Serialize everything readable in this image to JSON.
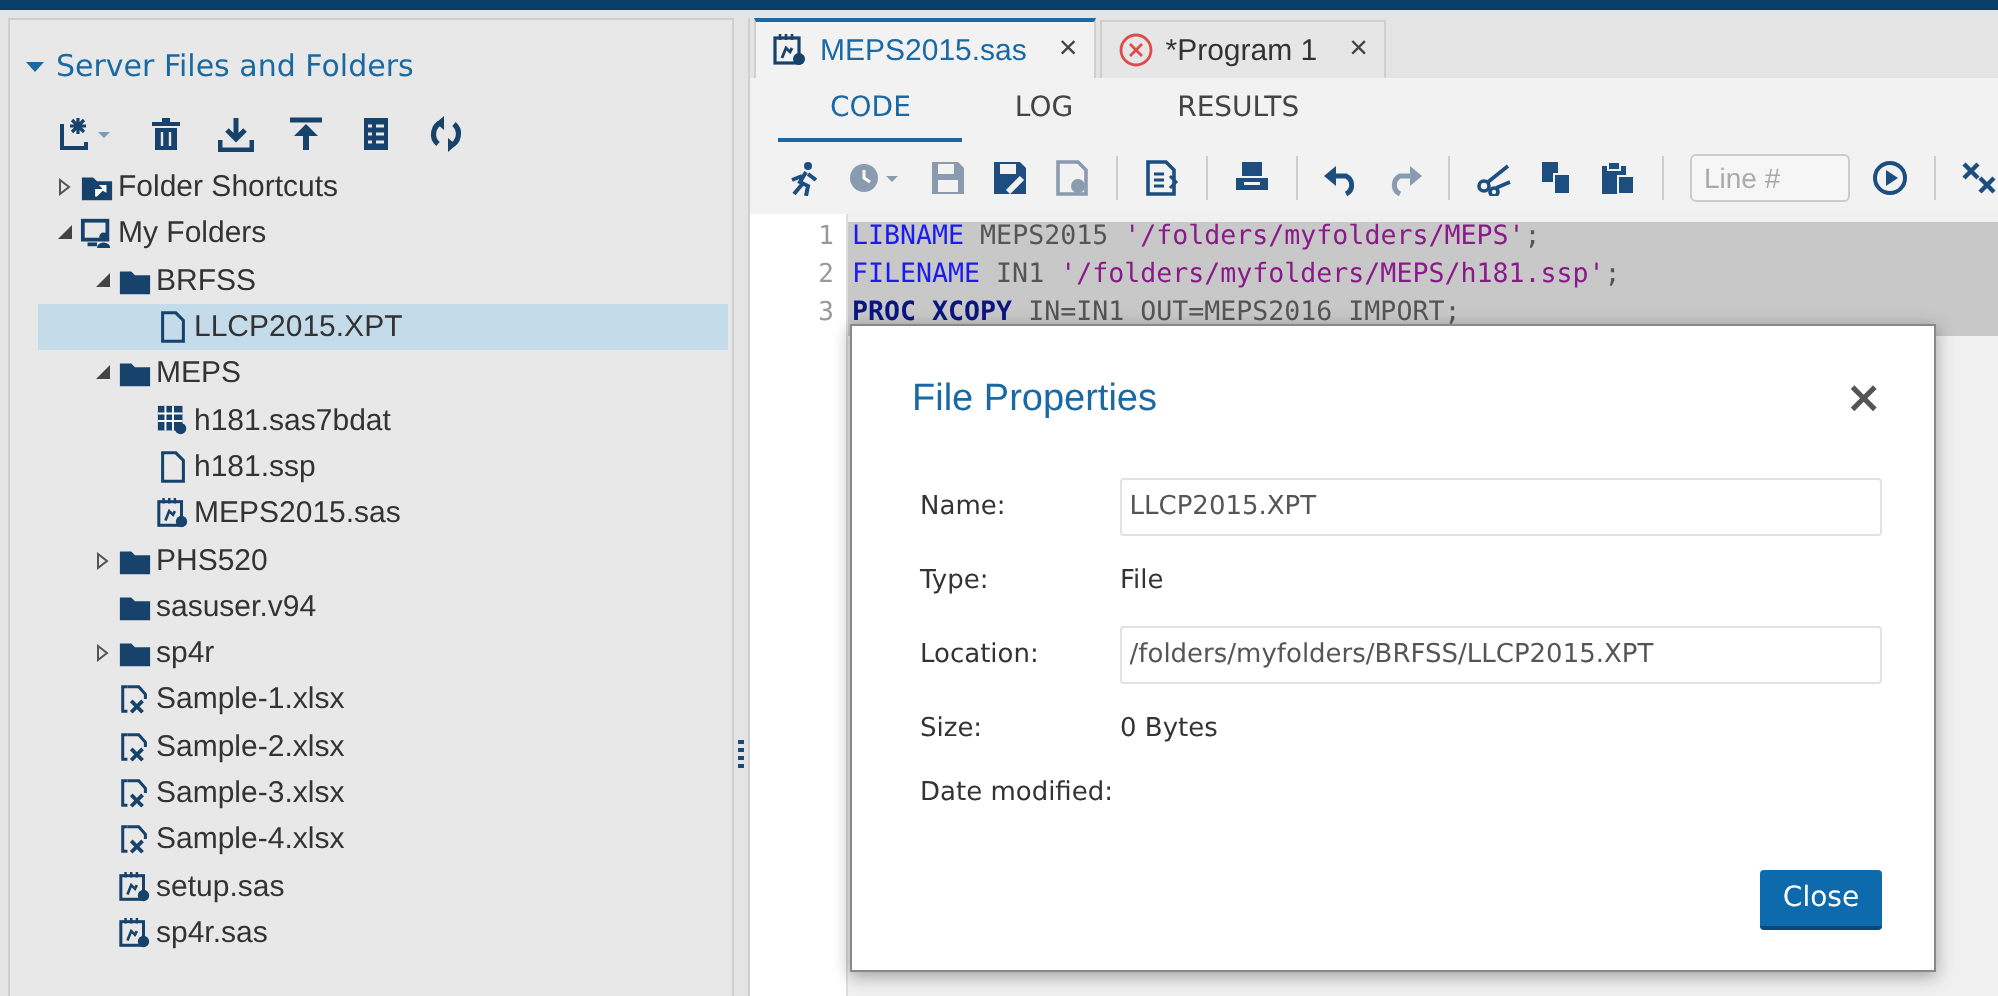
{
  "explorer": {
    "title": "Server Files and Folders",
    "expanded": true,
    "toolbar": [
      {
        "kind": "new"
      },
      {
        "kind": "delete"
      },
      {
        "kind": "download"
      },
      {
        "kind": "upload"
      },
      {
        "kind": "properties"
      },
      {
        "kind": "refresh"
      }
    ],
    "tree": [
      {
        "label": "Folder Shortcuts",
        "kind": "shortcut",
        "expanded": false,
        "selected": false
      },
      {
        "label": "My Folders",
        "kind": "computer",
        "expanded": true,
        "selected": false,
        "children": [
          {
            "label": "BRFSS",
            "kind": "folder",
            "expanded": true,
            "selected": false,
            "children": [
              {
                "label": "LLCP2015.XPT",
                "kind": "document",
                "selected": true
              }
            ]
          },
          {
            "label": "MEPS",
            "kind": "folder",
            "expanded": true,
            "selected": false,
            "children": [
              {
                "label": "h181.sas7bdat",
                "kind": "dataset",
                "selected": false
              },
              {
                "label": "h181.ssp",
                "kind": "document",
                "selected": false
              },
              {
                "label": "MEPS2015.sas",
                "kind": "program",
                "selected": false
              }
            ]
          },
          {
            "label": "PHS520",
            "kind": "folder",
            "expanded": false,
            "selected": false
          },
          {
            "label": "sasuser.v94",
            "kind": "folder",
            "selected": false
          },
          {
            "label": "sp4r",
            "kind": "folder",
            "expanded": false,
            "selected": false
          },
          {
            "label": "Sample-1.xlsx",
            "kind": "excel",
            "selected": false
          },
          {
            "label": "Sample-2.xlsx",
            "kind": "excel",
            "selected": false
          },
          {
            "label": "Sample-3.xlsx",
            "kind": "excel",
            "selected": false
          },
          {
            "label": "Sample-4.xlsx",
            "kind": "excel",
            "selected": false
          },
          {
            "label": "setup.sas",
            "kind": "program",
            "selected": false
          },
          {
            "label": "sp4r.sas",
            "kind": "program",
            "selected": false
          }
        ]
      }
    ]
  },
  "editor": {
    "tabs": [
      {
        "label": "MEPS2015.sas",
        "kind": "program",
        "selected": true,
        "close": "×"
      },
      {
        "label": "*Program 1",
        "kind": "error",
        "selected": false,
        "close": "×"
      }
    ],
    "subtabs": [
      {
        "label": "CODE",
        "selected": true
      },
      {
        "label": "LOG",
        "selected": false
      },
      {
        "label": "RESULTS",
        "selected": false
      }
    ],
    "toolbar": [
      {
        "kind": "run",
        "disabled": false
      },
      {
        "kind": "history",
        "disabled": true
      },
      {
        "kind": "save",
        "disabled": true
      },
      {
        "kind": "save-as",
        "disabled": false
      },
      {
        "kind": "save-other",
        "disabled": true
      },
      {
        "kind": "separator"
      },
      {
        "kind": "format",
        "disabled": false
      },
      {
        "kind": "separator"
      },
      {
        "kind": "print",
        "disabled": false
      },
      {
        "kind": "separator"
      },
      {
        "kind": "undo",
        "disabled": false
      },
      {
        "kind": "redo",
        "disabled": true
      },
      {
        "kind": "separator"
      },
      {
        "kind": "cut",
        "disabled": false
      },
      {
        "kind": "copy",
        "disabled": false
      },
      {
        "kind": "paste",
        "disabled": false
      },
      {
        "kind": "separator"
      },
      {
        "kind": "line-field",
        "placeholder": "Line #"
      },
      {
        "kind": "go",
        "disabled": false
      },
      {
        "kind": "separator"
      },
      {
        "kind": "clear",
        "disabled": false
      }
    ],
    "lines": [
      {
        "number": "1",
        "selected": true,
        "tokens": [
          {
            "kind": "keyword",
            "text": "LIBNAME"
          },
          {
            "kind": "plain",
            "text": " MEPS2015 "
          },
          {
            "kind": "string",
            "text": "'/folders/myfolders/MEPS'"
          },
          {
            "kind": "plain",
            "text": ";"
          }
        ]
      },
      {
        "number": "2",
        "selected": true,
        "tokens": [
          {
            "kind": "keyword",
            "text": "FILENAME"
          },
          {
            "kind": "plain",
            "text": " IN1 "
          },
          {
            "kind": "string",
            "text": "'/folders/myfolders/MEPS/h181.ssp'"
          },
          {
            "kind": "plain",
            "text": ";"
          }
        ]
      },
      {
        "number": "3",
        "selected": true,
        "tokens": [
          {
            "kind": "proc",
            "text": "PROC XCOPY"
          },
          {
            "kind": "plain",
            "text": " IN=IN1 OUT=MEPS2016 IMPORT;"
          }
        ]
      }
    ]
  },
  "dialog": {
    "title": "File Properties",
    "close": "×",
    "rows": [
      {
        "label": "Name:",
        "value": "LLCP2015.XPT",
        "kind": "field"
      },
      {
        "label": "Type:",
        "value": "File",
        "kind": "text"
      },
      {
        "label": "Location:",
        "value": "/folders/myfolders/BRFSS/LLCP2015.XPT",
        "kind": "field"
      },
      {
        "label": "Size:",
        "value": "0 Bytes",
        "kind": "text"
      },
      {
        "label": "Date modified:"
      }
    ],
    "button": "Close"
  }
}
